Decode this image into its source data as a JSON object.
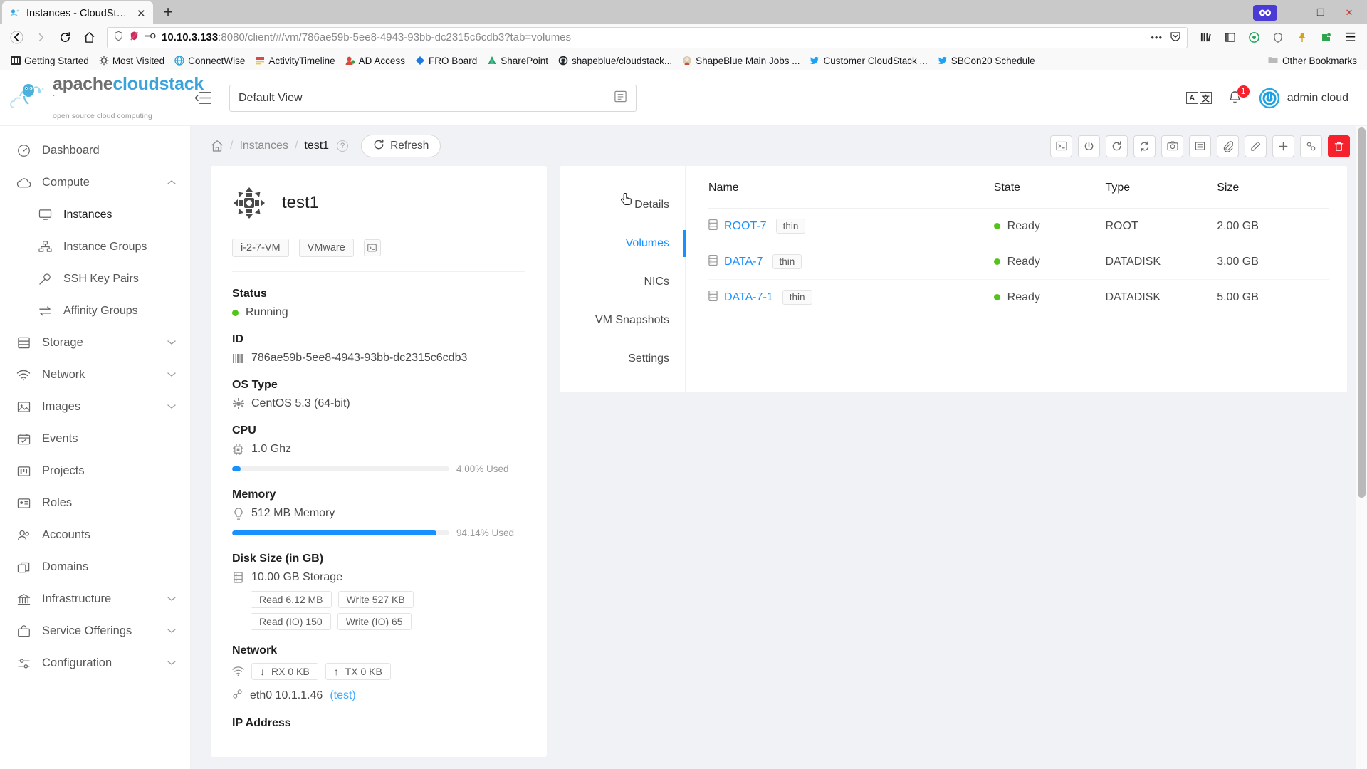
{
  "browser": {
    "tab": {
      "title": "Instances - CloudStack",
      "favicon": "cloudstack-favicon",
      "close_label": "✕"
    },
    "new_tab_label": "+",
    "window_controls": {
      "minimize": "—",
      "maximize": "❐",
      "close": "✕"
    },
    "nav": {
      "back": "←",
      "forward": "→",
      "reload": "↻",
      "home": "⌂"
    },
    "url": {
      "host": "10.10.3.133",
      "rest": ":8080/client/#/vm/786ae59b-5ee8-4943-93bb-dc2315c6cdb3?tab=volumes"
    },
    "url_actions": {
      "more": "•••",
      "pocket": "pocket-icon"
    },
    "toolbar_right": {
      "library": "library-icon",
      "sidebar": "sidebar-icon",
      "container": "container-icon",
      "shield": "shield-icon",
      "pin": "pin-icon",
      "extension": "extension-icon",
      "menu": "☰"
    },
    "bookmarks": [
      {
        "label": "Getting Started",
        "icon": "getting-started-icon",
        "color": "#2b2b2b"
      },
      {
        "label": "Most Visited",
        "icon": "gear-icon",
        "color": "#4a4a4a"
      },
      {
        "label": "ConnectWise",
        "icon": "globe-icon",
        "color": "#29a8e0"
      },
      {
        "label": "ActivityTimeline",
        "icon": "timeline-icon",
        "color": "#d64a4a"
      },
      {
        "label": "AD Access",
        "icon": "contacts-icon",
        "color": "#d94a3a"
      },
      {
        "label": "FRO Board",
        "icon": "diamond-icon",
        "color": "#1f7ae0"
      },
      {
        "label": "SharePoint",
        "icon": "sharepoint-icon",
        "color": "#1f9d6a"
      },
      {
        "label": "shapeblue/cloudstack...",
        "icon": "github-icon",
        "color": "#24292e"
      },
      {
        "label": "ShapeBlue Main Jobs ...",
        "icon": "jenkins-icon",
        "color": "#c9b89a"
      },
      {
        "label": "Customer CloudStack ...",
        "icon": "twitter-icon",
        "color": "#1da1f2"
      },
      {
        "label": "SBCon20 Schedule",
        "icon": "twitter-icon",
        "color": "#1da1f2"
      }
    ],
    "other_bookmarks": {
      "label": "Other Bookmarks",
      "icon": "folder-icon"
    }
  },
  "header": {
    "logo": {
      "apache": "apache",
      "cloudstack": "cloudstack",
      "tm": "´",
      "tagline": "open source cloud computing"
    },
    "collapse_icon": "menu-collapse-icon",
    "view_select": {
      "value": "Default View",
      "icon": "view-list-icon"
    },
    "lang": {
      "a": "A",
      "b": "文"
    },
    "notifications": {
      "icon": "bell-icon",
      "count": "1"
    },
    "user": {
      "name": "admin cloud",
      "avatar": "user-avatar"
    }
  },
  "sidebar": {
    "items": [
      {
        "label": "Dashboard",
        "icon": "dashboard-icon",
        "level": 0,
        "chevron": ""
      },
      {
        "label": "Compute",
        "icon": "cloud-icon",
        "level": 0,
        "chevron": "⌃"
      },
      {
        "label": "Instances",
        "icon": "monitor-icon",
        "level": 1,
        "chevron": "",
        "active": true
      },
      {
        "label": "Instance Groups",
        "icon": "group-icon",
        "level": 1,
        "chevron": ""
      },
      {
        "label": "SSH Key Pairs",
        "icon": "key-icon",
        "level": 1,
        "chevron": ""
      },
      {
        "label": "Affinity Groups",
        "icon": "swap-icon",
        "level": 1,
        "chevron": ""
      },
      {
        "label": "Storage",
        "icon": "storage-icon",
        "level": 0,
        "chevron": "⌄"
      },
      {
        "label": "Network",
        "icon": "wifi-icon",
        "level": 0,
        "chevron": "⌄"
      },
      {
        "label": "Images",
        "icon": "image-icon",
        "level": 0,
        "chevron": "⌄"
      },
      {
        "label": "Events",
        "icon": "calendar-icon",
        "level": 0,
        "chevron": ""
      },
      {
        "label": "Projects",
        "icon": "projects-icon",
        "level": 0,
        "chevron": ""
      },
      {
        "label": "Roles",
        "icon": "idcard-icon",
        "level": 0,
        "chevron": ""
      },
      {
        "label": "Accounts",
        "icon": "accounts-icon",
        "level": 0,
        "chevron": ""
      },
      {
        "label": "Domains",
        "icon": "domains-icon",
        "level": 0,
        "chevron": ""
      },
      {
        "label": "Infrastructure",
        "icon": "bank-icon",
        "level": 0,
        "chevron": "⌄"
      },
      {
        "label": "Service Offerings",
        "icon": "shopping-icon",
        "level": 0,
        "chevron": "⌄"
      },
      {
        "label": "Configuration",
        "icon": "sliders-icon",
        "level": 0,
        "chevron": "⌄"
      }
    ]
  },
  "breadcrumb": {
    "home_icon": "home-icon",
    "items": [
      "Instances",
      "test1"
    ],
    "help_icon": "?",
    "refresh": {
      "label": "Refresh",
      "icon": "refresh-icon"
    }
  },
  "action_bar": {
    "buttons": [
      {
        "name": "console-button",
        "icon": "console-icon"
      },
      {
        "name": "power-button",
        "icon": "power-icon"
      },
      {
        "name": "reboot-button",
        "icon": "reboot-icon"
      },
      {
        "name": "reinstall-button",
        "icon": "reinstall-icon"
      },
      {
        "name": "snapshot-button",
        "icon": "camera-icon"
      },
      {
        "name": "vm-snapshot-button",
        "icon": "vm-snapshot-icon"
      },
      {
        "name": "attach-iso-button",
        "icon": "paperclip-icon"
      },
      {
        "name": "edit-button",
        "icon": "edit-icon"
      },
      {
        "name": "scale-vm-button",
        "icon": "plus-icon"
      },
      {
        "name": "migrate-button",
        "icon": "link-icon"
      },
      {
        "name": "destroy-button",
        "icon": "trash-icon",
        "danger": true
      }
    ]
  },
  "vm": {
    "name": "test1",
    "icon": "vmware-vm-icon",
    "tags": [
      "i-2-7-VM",
      "VMware"
    ],
    "console_btn_icon": "terminal-icon",
    "fields": {
      "status": {
        "label": "Status",
        "value": "Running",
        "state_color": "#52c41a"
      },
      "id": {
        "label": "ID",
        "value": "786ae59b-5ee8-4943-93bb-dc2315c6cdb3",
        "icon": "barcode-icon"
      },
      "os_type": {
        "label": "OS Type",
        "value": "CentOS 5.3 (64-bit)",
        "icon": "gear-icon"
      },
      "cpu": {
        "label": "CPU",
        "value": "1.0 Ghz",
        "icon": "cpu-icon",
        "used_label": "4.00% Used",
        "used_pct": 4
      },
      "memory": {
        "label": "Memory",
        "value": "512 MB Memory",
        "icon": "bulb-icon",
        "used_label": "94.14% Used",
        "used_pct": 94.14
      },
      "disk": {
        "label": "Disk Size (in GB)",
        "value": "10.00 GB Storage",
        "icon": "database-icon",
        "chips": [
          [
            "Read 6.12 MB",
            "Write 527 KB"
          ],
          [
            "Read (IO) 150",
            "Write (IO) 65"
          ]
        ]
      },
      "network": {
        "label": "Network",
        "icon": "wifi-icon",
        "rx": "RX 0 KB",
        "tx": "TX 0 KB",
        "rx_arrow": "↓",
        "tx_arrow": "↑",
        "nic_icon": "api-icon",
        "nic": "eth0 10.1.1.46",
        "nic_network": "(test)"
      },
      "ip_address": {
        "label": "IP Address"
      }
    }
  },
  "detail_tabs": [
    {
      "label": "Details",
      "active": false
    },
    {
      "label": "Volumes",
      "active": true
    },
    {
      "label": "NICs",
      "active": false
    },
    {
      "label": "VM Snapshots",
      "active": false
    },
    {
      "label": "Settings",
      "active": false
    }
  ],
  "volumes_table": {
    "columns": [
      "Name",
      "State",
      "Type",
      "Size"
    ],
    "rows": [
      {
        "icon": "volume-icon",
        "name": "ROOT-7",
        "tag": "thin",
        "state": "Ready",
        "state_color": "#52c41a",
        "type": "ROOT",
        "size": "2.00 GB"
      },
      {
        "icon": "volume-icon",
        "name": "DATA-7",
        "tag": "thin",
        "state": "Ready",
        "state_color": "#52c41a",
        "type": "DATADISK",
        "size": "3.00 GB"
      },
      {
        "icon": "volume-icon",
        "name": "DATA-7-1",
        "tag": "thin",
        "state": "Ready",
        "state_color": "#52c41a",
        "type": "DATADISK",
        "size": "5.00 GB"
      }
    ]
  },
  "colors": {
    "accent": "#1890ff",
    "success": "#52c41a",
    "danger": "#f5222d",
    "brand": "#3aa3dc"
  }
}
